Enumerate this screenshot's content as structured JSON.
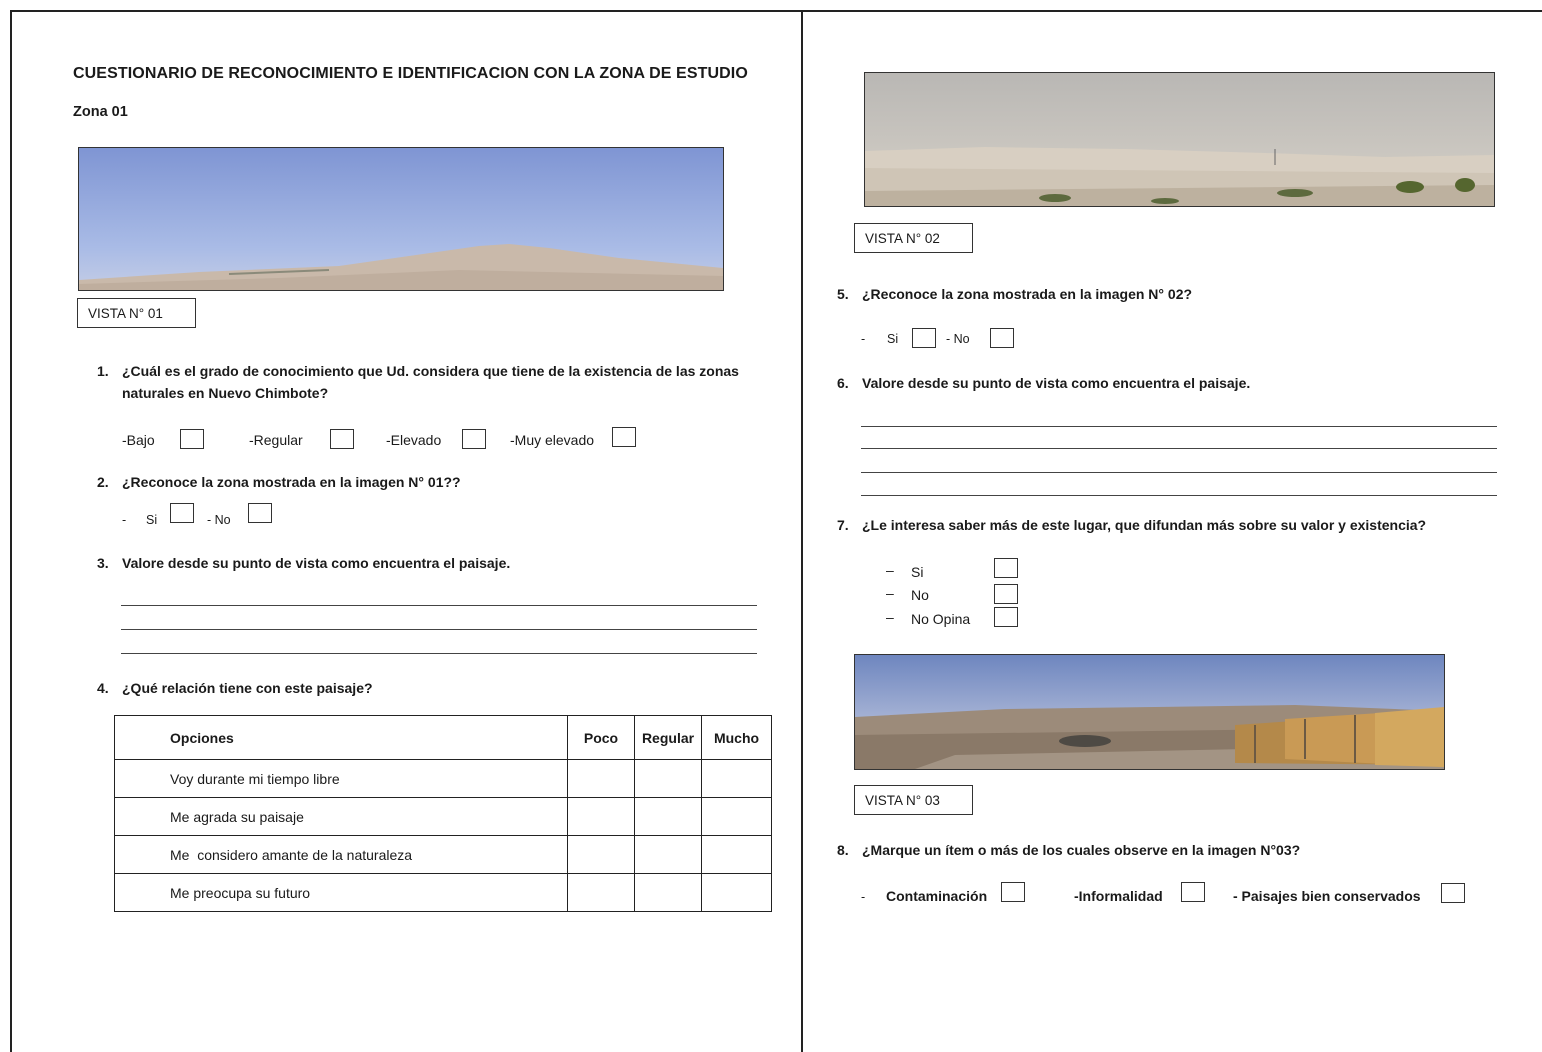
{
  "page": {
    "title": "CUESTIONARIO DE RECONOCIMIENTO E IDENTIFICACION CON LA ZONA DE ESTUDIO",
    "zona": "Zona 01"
  },
  "vistas": {
    "v1": "VISTA N° 01",
    "v2": "VISTA N° 02",
    "v3": "VISTA N° 03"
  },
  "questions": {
    "q1": {
      "num": "1.",
      "line1": "¿Cuál es el grado de conocimiento que Ud. considera que tiene de la existencia de las zonas",
      "line2": "naturales en Nuevo Chimbote?",
      "options": [
        "-Bajo",
        "-Regular",
        "-Elevado",
        "-Muy elevado"
      ]
    },
    "q2": {
      "num": "2.",
      "text": "¿Reconoce la zona mostrada en la imagen N° 01??",
      "dash": "-",
      "si": "Si",
      "no": "- No"
    },
    "q3": {
      "num": "3.",
      "text": "Valore desde su punto de vista como encuentra el paisaje."
    },
    "q4": {
      "num": "4.",
      "text": "¿Qué relación tiene con este paisaje?",
      "headers": [
        "Opciones",
        "Poco",
        "Regular",
        "Mucho"
      ],
      "rows": [
        "Voy durante mi tiempo libre",
        "Me agrada su paisaje",
        "Me  considero amante de la naturaleza",
        "Me preocupa su futuro"
      ]
    },
    "q5": {
      "num": "5.",
      "text": "¿Reconoce la zona mostrada en la imagen N° 02?",
      "dash": "-",
      "si": "Si",
      "no": "- No"
    },
    "q6": {
      "num": "6.",
      "text": "Valore desde su punto de vista como encuentra el paisaje."
    },
    "q7": {
      "num": "7.",
      "text": "¿Le interesa saber más de este lugar, que difundan más sobre su valor y existencia?",
      "dash": "–",
      "options": [
        "Si",
        "No",
        "No Opina"
      ]
    },
    "q8": {
      "num": "8.",
      "text": "¿Marque un ítem o más de los cuales observe en la imagen N°03?",
      "dash": "-",
      "options": [
        "Contaminación",
        "-Informalidad",
        "- Paisajes bien conservados"
      ]
    }
  }
}
